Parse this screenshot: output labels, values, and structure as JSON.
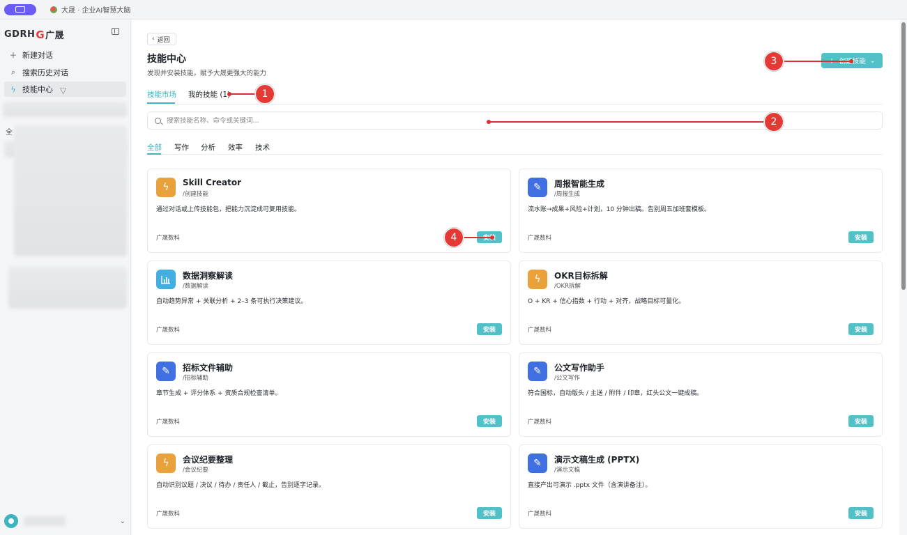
{
  "window": {
    "tab_title": "大晟 · 企业AI智慧大脑"
  },
  "sidebar": {
    "logo_prefix": "GDRH",
    "logo_swirl": "G",
    "logo_suffix": "广晟",
    "items": [
      {
        "label": "新建对话",
        "icon": "plus-icon"
      },
      {
        "label": "搜索历史对话",
        "icon": "search-icon"
      },
      {
        "label": "技能中心",
        "icon": "lightning-icon"
      }
    ],
    "section_label": "全"
  },
  "header": {
    "back_label": "返回",
    "title": "技能中心",
    "subtitle": "发现并安装技能，赋予大晟更强大的能力",
    "create_label": "创建技能"
  },
  "tabs": [
    {
      "label": "技能市场",
      "active": true
    },
    {
      "label": "我的技能 (1)",
      "active": false
    }
  ],
  "search": {
    "placeholder": "搜索技能名称、命令或关键词..."
  },
  "categories": [
    {
      "label": "全部",
      "active": true
    },
    {
      "label": "写作",
      "active": false
    },
    {
      "label": "分析",
      "active": false
    },
    {
      "label": "效率",
      "active": false
    },
    {
      "label": "技术",
      "active": false
    }
  ],
  "skills": [
    {
      "name": "Skill Creator",
      "command": "/创建技能",
      "description": "通过对话或上传技能包，把能力沉淀成可复用技能。",
      "vendor": "广晟数科",
      "action": "安装",
      "icon": "lightning-icon",
      "color": "orange"
    },
    {
      "name": "周报智能生成",
      "command": "/周报生成",
      "description": "流水账→成果+风险+计划，10 分钟出稿。告别周五加班套模板。",
      "vendor": "广晟数科",
      "action": "安装",
      "icon": "edit-icon",
      "color": "blue"
    },
    {
      "name": "数据洞察解读",
      "command": "/数据解读",
      "description": "自动趋势异常 + 关联分析 + 2–3 条可执行决策建议。",
      "vendor": "广晟数科",
      "action": "安装",
      "icon": "chart-icon",
      "color": "cyan"
    },
    {
      "name": "OKR目标拆解",
      "command": "/OKR拆解",
      "description": "O + KR + 信心指数 + 行动 + 对齐，战略目标可量化。",
      "vendor": "广晟数科",
      "action": "安装",
      "icon": "lightning-icon",
      "color": "orange"
    },
    {
      "name": "招标文件辅助",
      "command": "/招标辅助",
      "description": "章节生成 + 评分体系 + 资质合规检查清单。",
      "vendor": "广晟数科",
      "action": "安装",
      "icon": "edit-icon",
      "color": "blue"
    },
    {
      "name": "公文写作助手",
      "command": "/公文写作",
      "description": "符合国标，自动版头 / 主送 / 附件 / 印章，红头公文一键成稿。",
      "vendor": "广晟数科",
      "action": "安装",
      "icon": "edit-icon",
      "color": "blue"
    },
    {
      "name": "会议纪要整理",
      "command": "/会议纪要",
      "description": "自动识别议题 / 决议 / 待办 / 责任人 / 截止，告别逐字记录。",
      "vendor": "广晟数科",
      "action": "安装",
      "icon": "lightning-icon",
      "color": "orange"
    },
    {
      "name": "演示文稿生成 (PPTX)",
      "command": "/演示文稿",
      "description": "直接产出可演示 .pptx 文件（含演讲备注）。",
      "vendor": "广晟数科",
      "action": "安装",
      "icon": "edit-icon",
      "color": "blue"
    }
  ],
  "annotations": [
    {
      "number": "1"
    },
    {
      "number": "2"
    },
    {
      "number": "3"
    },
    {
      "number": "4"
    }
  ],
  "colors": {
    "accent": "#52c0c7",
    "marker": "#e53935",
    "orange": "#e9a23b",
    "blue": "#3f6fe0",
    "cyan": "#43aee0"
  }
}
